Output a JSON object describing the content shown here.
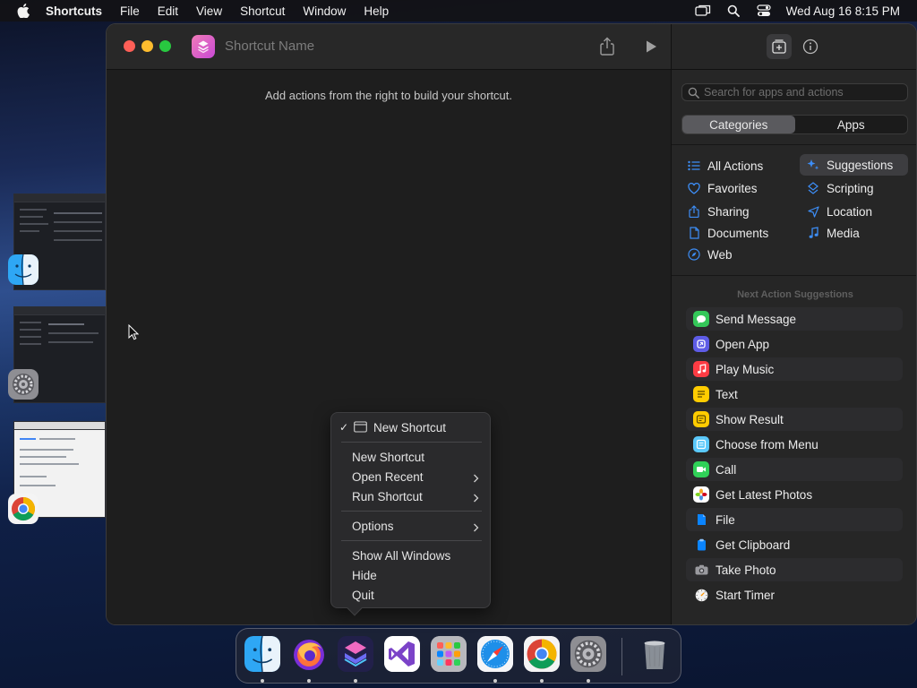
{
  "menubar": {
    "apple_icon": "apple-logo",
    "items": [
      {
        "label": "Shortcuts",
        "bold": true
      },
      {
        "label": "File"
      },
      {
        "label": "Edit"
      },
      {
        "label": "View"
      },
      {
        "label": "Shortcut"
      },
      {
        "label": "Window"
      },
      {
        "label": "Help"
      }
    ],
    "status_icons": [
      "screen-mirroring-icon",
      "spotlight-search-icon",
      "control-center-icon"
    ],
    "clock": "Wed Aug 16  8:15 PM"
  },
  "window": {
    "shortcut_name_placeholder": "Shortcut Name",
    "editor_hint": "Add actions from the right to build your shortcut.",
    "toolbar_icons": [
      "share-icon",
      "play-icon"
    ]
  },
  "sidebar": {
    "toolbar_icons": [
      "add-to-library-icon",
      "info-icon"
    ],
    "search_placeholder": "Search for apps and actions",
    "segments": [
      "Categories",
      "Apps"
    ],
    "active_segment": "Categories",
    "categories_left": [
      {
        "label": "All Actions",
        "icon": "list-icon"
      },
      {
        "label": "Favorites",
        "icon": "heart-icon"
      },
      {
        "label": "Sharing",
        "icon": "share-icon"
      },
      {
        "label": "Documents",
        "icon": "document-icon"
      },
      {
        "label": "Web",
        "icon": "compass-icon"
      }
    ],
    "categories_right": [
      {
        "label": "Suggestions",
        "icon": "sparkle-icon",
        "selected": true
      },
      {
        "label": "Scripting",
        "icon": "scripting-icon"
      },
      {
        "label": "Location",
        "icon": "location-arrow-icon"
      },
      {
        "label": "Media",
        "icon": "music-note-icon"
      }
    ],
    "next_action_title": "Next Action Suggestions",
    "suggestions": [
      {
        "label": "Send Message",
        "icon": "messages-icon",
        "color": "#34c759"
      },
      {
        "label": "Open App",
        "icon": "open-app-icon",
        "color": "#5e5ce6"
      },
      {
        "label": "Play Music",
        "icon": "music-icon",
        "color": "#fc3c44"
      },
      {
        "label": "Text",
        "icon": "text-icon",
        "color": "#ffcc00"
      },
      {
        "label": "Show Result",
        "icon": "show-result-icon",
        "color": "#ffcc00"
      },
      {
        "label": "Choose from Menu",
        "icon": "menu-icon",
        "color": "#5ac8fa"
      },
      {
        "label": "Call",
        "icon": "phone-icon",
        "color": "#30d158"
      },
      {
        "label": "Get Latest Photos",
        "icon": "photos-icon",
        "color": "#ffffff"
      },
      {
        "label": "File",
        "icon": "file-icon",
        "color": "#0a84ff"
      },
      {
        "label": "Get Clipboard",
        "icon": "clipboard-icon",
        "color": "#0a84ff"
      },
      {
        "label": "Take Photo",
        "icon": "camera-icon",
        "color": "#8e8e93"
      },
      {
        "label": "Start Timer",
        "icon": "timer-icon",
        "color": "#ffffff"
      }
    ]
  },
  "context_menu": {
    "checked_item": "New Shortcut",
    "items": [
      {
        "label": "New Shortcut",
        "submenu": false
      },
      {
        "label": "Open Recent",
        "submenu": true
      },
      {
        "label": "Run Shortcut",
        "submenu": true
      },
      {
        "label": "Options",
        "submenu": true
      },
      {
        "label": "Show All Windows",
        "submenu": false
      },
      {
        "label": "Hide",
        "submenu": false
      },
      {
        "label": "Quit",
        "submenu": false
      }
    ]
  },
  "dock": {
    "apps": [
      {
        "name": "Finder",
        "icon": "finder-icon",
        "running": true
      },
      {
        "name": "Firefox",
        "icon": "firefox-icon",
        "running": true
      },
      {
        "name": "Shortcuts",
        "icon": "shortcuts-icon",
        "running": true
      },
      {
        "name": "Visual Studio",
        "icon": "visual-studio-icon",
        "running": false
      },
      {
        "name": "Launchpad",
        "icon": "launchpad-icon",
        "running": false
      },
      {
        "name": "Safari",
        "icon": "safari-icon",
        "running": true
      },
      {
        "name": "Chrome",
        "icon": "chrome-icon",
        "running": true
      },
      {
        "name": "System Settings",
        "icon": "settings-icon",
        "running": true
      },
      {
        "name": "Trash",
        "icon": "trash-icon",
        "running": false
      }
    ]
  },
  "desktop_windows": [
    "Finder window thumbnail",
    "System Settings window thumbnail",
    "Chrome window thumbnail"
  ]
}
